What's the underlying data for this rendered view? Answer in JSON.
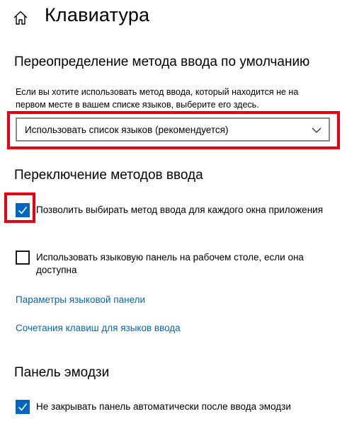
{
  "header": {
    "title": "Клавиатура",
    "home_icon": "home-icon"
  },
  "input_override": {
    "title": "Переопределение метода ввода по умолчанию",
    "description": "Если вы хотите использовать метод ввода, который находится не на первом месте в вашем списке языков, выберите его здесь.",
    "dropdown_value": "Использовать список языков (рекомендуется)"
  },
  "switching": {
    "title": "Переключение методов ввода",
    "options": [
      {
        "label": "Позволить выбирать метод ввода для каждого окна приложения",
        "checked": true
      },
      {
        "label": "Использовать языковую панель на рабочем столе, если она доступна",
        "checked": false
      }
    ],
    "links": [
      "Параметры языковой панели",
      "Сочетания клавиш для языков ввода"
    ]
  },
  "emoji": {
    "title": "Панель эмодзи",
    "options": [
      {
        "label": "Не закрывать панель автоматически после ввода эмодзи",
        "checked": true
      }
    ]
  },
  "colors": {
    "accent": "#0067c0",
    "link": "#0067b8",
    "highlight": "#e60012"
  }
}
